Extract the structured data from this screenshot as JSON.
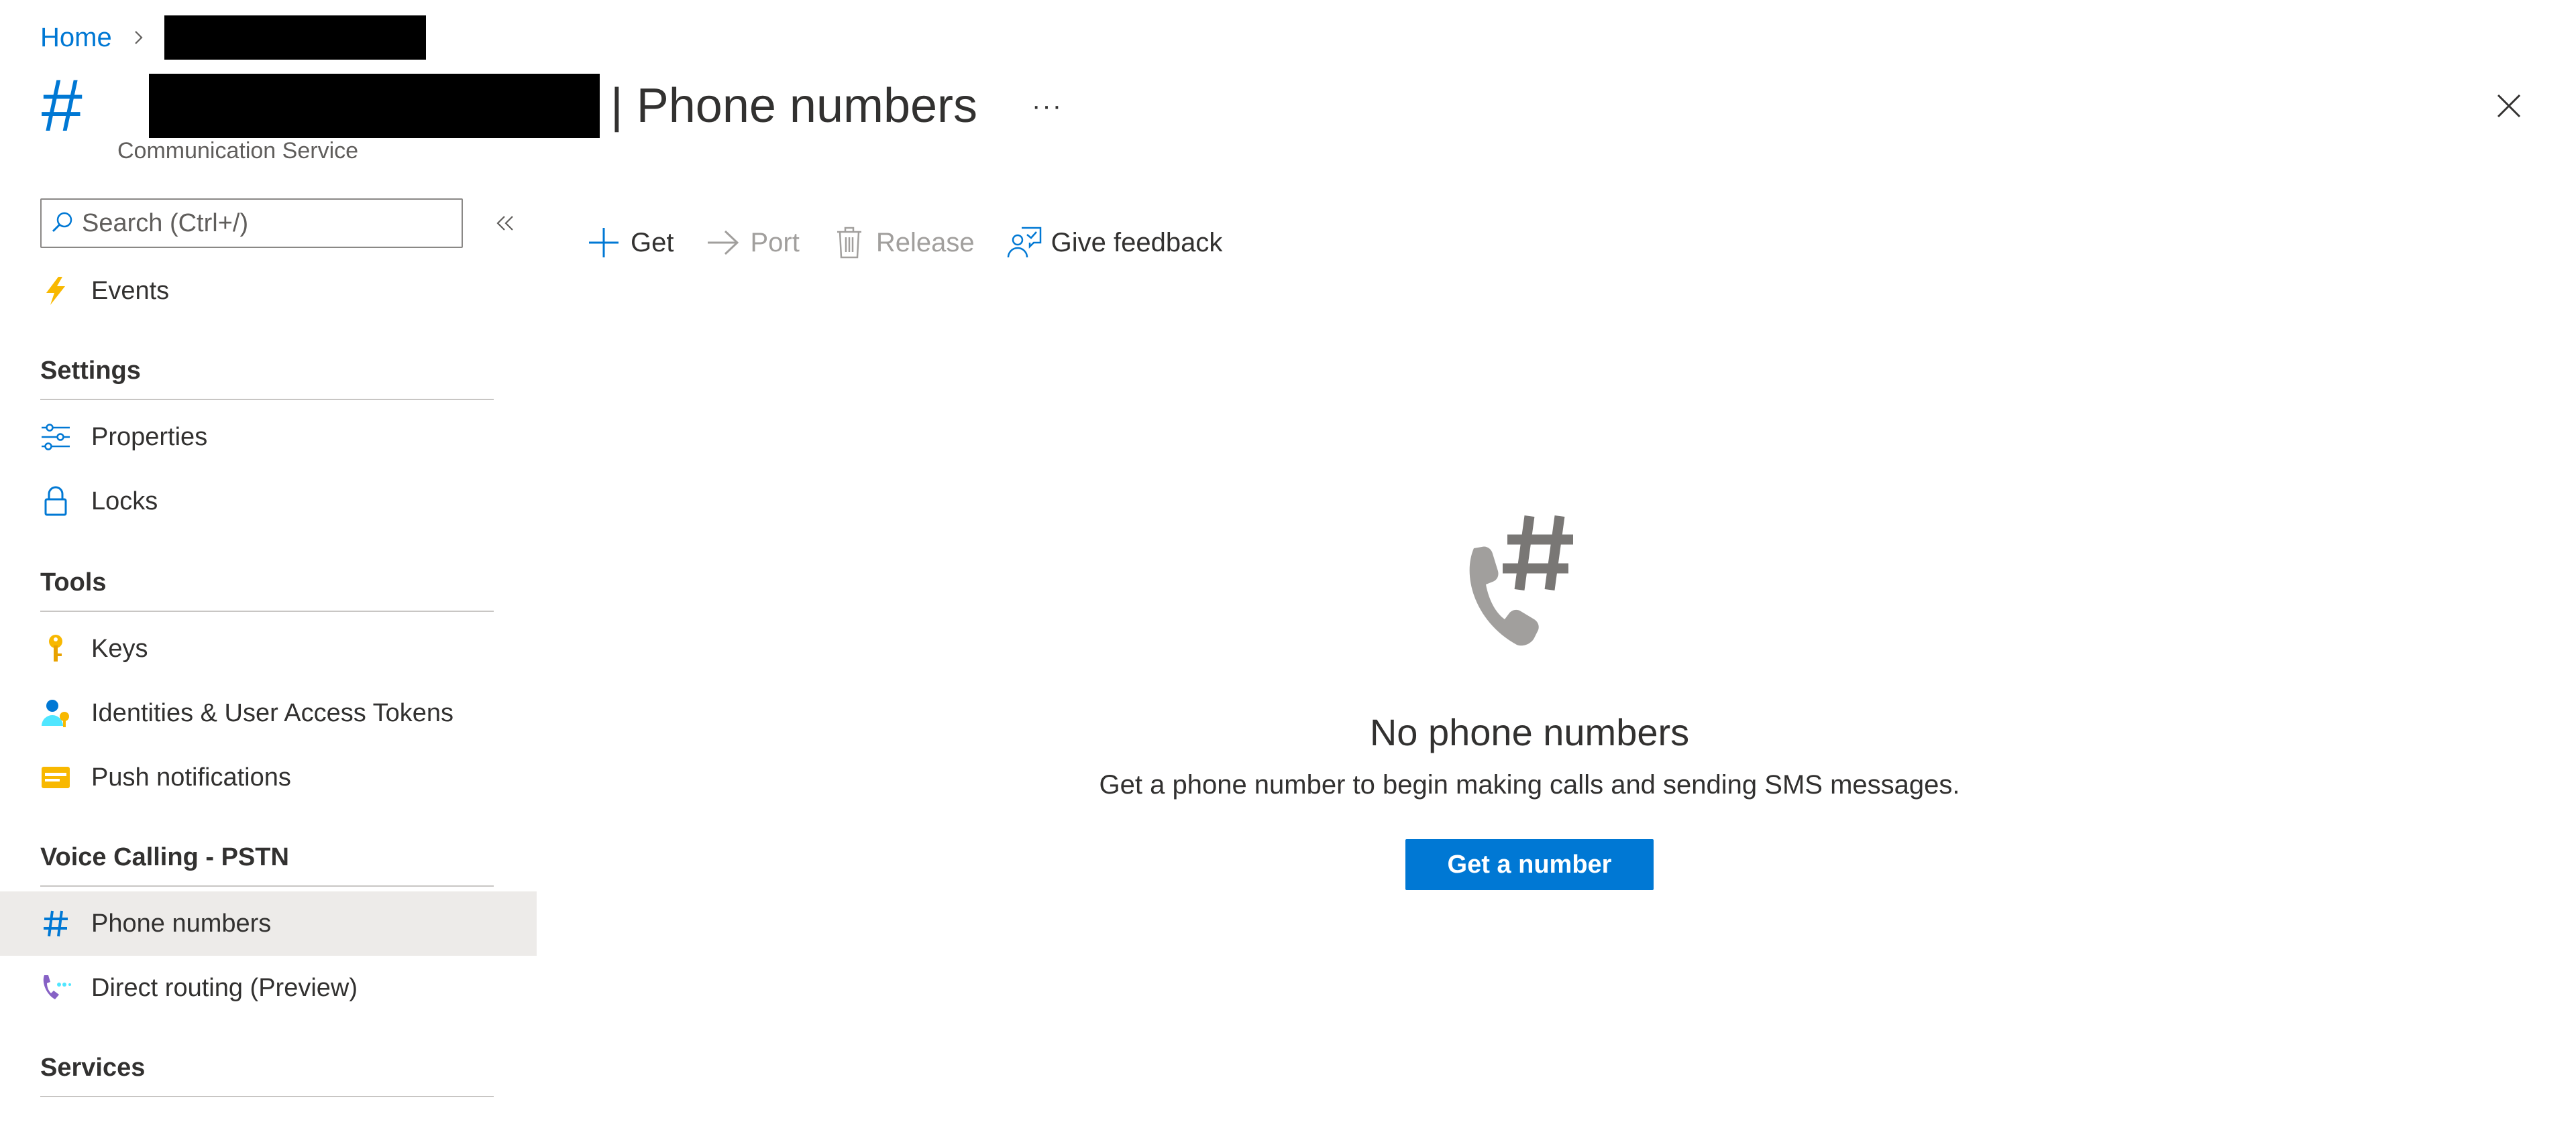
{
  "breadcrumb": {
    "home": "Home"
  },
  "header": {
    "title": "| Phone numbers",
    "subtitle": "Communication Service",
    "more": "···",
    "hash_glyph": "#"
  },
  "search": {
    "placeholder": "Search (Ctrl+/)"
  },
  "sidebar": {
    "items_top": [
      {
        "label": "Events",
        "icon": "lightning-icon"
      }
    ],
    "sections": [
      {
        "title": "Settings",
        "items": [
          {
            "label": "Properties",
            "icon": "sliders-icon"
          },
          {
            "label": "Locks",
            "icon": "lock-icon"
          }
        ]
      },
      {
        "title": "Tools",
        "items": [
          {
            "label": "Keys",
            "icon": "key-icon"
          },
          {
            "label": "Identities & User Access Tokens",
            "icon": "user-key-icon"
          },
          {
            "label": "Push notifications",
            "icon": "notification-card-icon"
          }
        ]
      },
      {
        "title": "Voice Calling - PSTN",
        "items": [
          {
            "label": "Phone numbers",
            "icon": "hash-icon",
            "active": true
          },
          {
            "label": "Direct routing (Preview)",
            "icon": "phone-routing-icon"
          }
        ]
      },
      {
        "title": "Services",
        "items": []
      }
    ]
  },
  "toolbar": {
    "get": "Get",
    "port": "Port",
    "release": "Release",
    "feedback": "Give feedback"
  },
  "empty_state": {
    "title": "No phone numbers",
    "description": "Get a phone number to begin making calls and sending SMS messages.",
    "button": "Get a number"
  },
  "colors": {
    "accent": "#0078d4",
    "text": "#323130",
    "disabled": "#a19f9d",
    "active_bg": "#edebe9"
  }
}
